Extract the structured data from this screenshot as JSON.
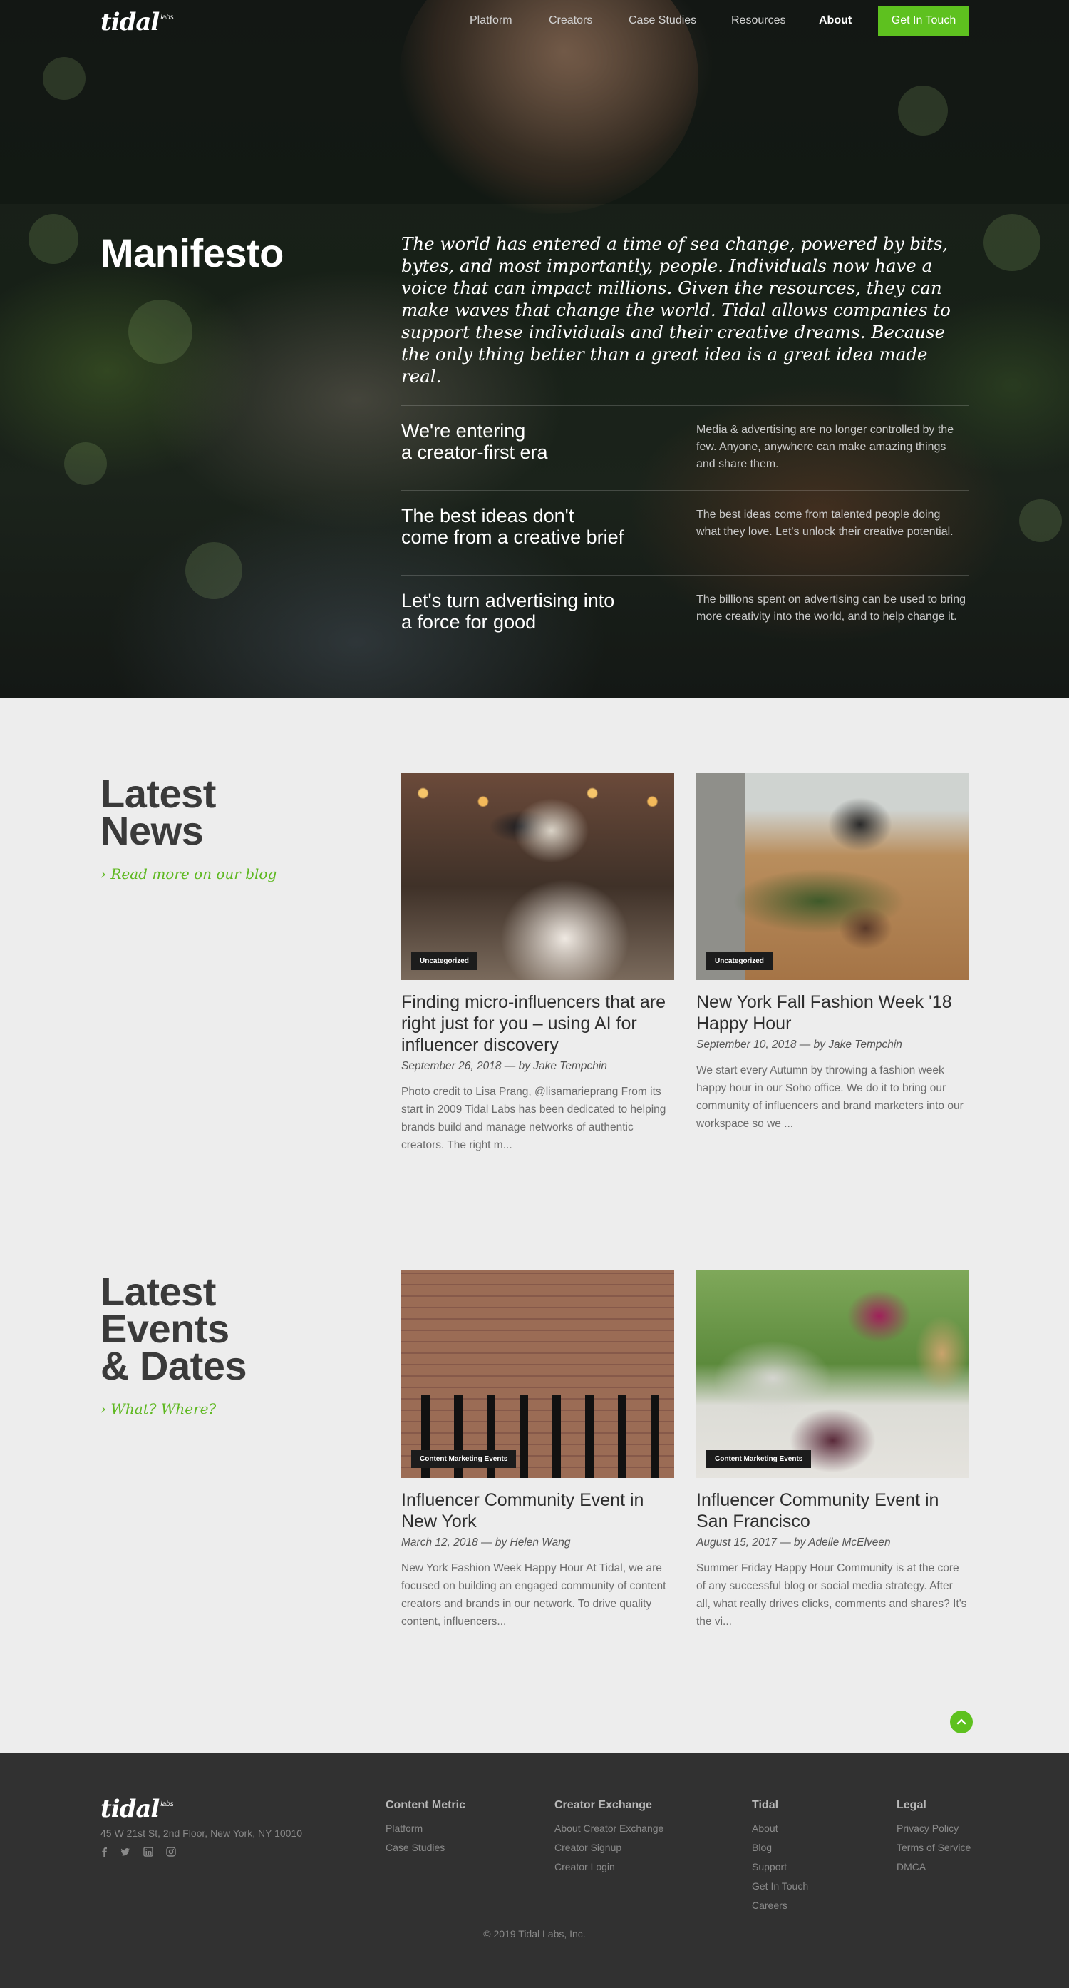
{
  "brand": {
    "logo_word": "tidal",
    "logo_sub": "labs"
  },
  "nav": {
    "items": [
      "Platform",
      "Creators",
      "Case Studies",
      "Resources",
      "About"
    ],
    "active": "About",
    "cta_label": "Get In Touch"
  },
  "manifesto": {
    "title": "Manifesto",
    "text": "The world has entered a time of sea change, powered by bits, bytes, and most importantly, people. Individuals now have a voice that can impact millions. Given the resources, they can make waves that change the world. Tidal allows companies to support these individuals and their creative dreams. Because the only thing better than a great idea is a great idea made real.",
    "rows": [
      {
        "heading_l1": "We're entering",
        "heading_l2": "a creator-first era",
        "body": "Media & advertising are no longer controlled by the few. Anyone, anywhere can make amazing things and share them."
      },
      {
        "heading_l1": "The best ideas don't",
        "heading_l2": "come from a creative brief",
        "body": "The best ideas come from talented people doing what they love. Let's unlock their creative potential."
      },
      {
        "heading_l1": "Let's turn advertising into",
        "heading_l2": "a force for good",
        "body": "The billions spent on advertising can be used to bring more creativity into the world, and to help change it."
      }
    ]
  },
  "news": {
    "title_l1": "Latest",
    "title_l2": "News",
    "link": "› Read more on our blog",
    "cards": [
      {
        "badge": "Uncategorized",
        "title": "Finding micro-influencers that are right just for you – using AI for influencer discovery",
        "meta": "September 26, 2018 — by Jake Tempchin",
        "excerpt": "Photo credit to Lisa Prang, @lisamarieprang From its start in 2009 Tidal Labs has been dedicated to helping brands build and manage networks of authentic creators. The right m..."
      },
      {
        "badge": "Uncategorized",
        "title": "New York Fall Fashion Week '18 Happy Hour",
        "meta": "September 10, 2018 — by Jake Tempchin",
        "excerpt": "We start every Autumn by throwing a fashion week happy hour in our Soho office. We do it to bring our community of influencers and brand marketers into our workspace so we ..."
      }
    ]
  },
  "events": {
    "title_l1": "Latest",
    "title_l2": "Events",
    "title_l3": "& Dates",
    "link": "› What? Where?",
    "cards": [
      {
        "badge": "Content Marketing Events",
        "title": "Influencer Community Event in New York",
        "meta": "March 12, 2018 — by Helen Wang",
        "excerpt": "New York Fashion Week Happy Hour At Tidal, we are focused on building an engaged community of content creators and brands in our network. To drive quality content, influencers..."
      },
      {
        "badge": "Content Marketing Events",
        "title": "Influencer Community Event in San Francisco",
        "meta": "August 15, 2017 — by Adelle McElveen",
        "excerpt": "Summer Friday Happy Hour Community is at the core of any successful blog or social media strategy. After all, what really drives clicks, comments and shares? It's the vi..."
      }
    ]
  },
  "footer": {
    "address": "45 W 21st St, 2nd Floor, New York, NY 10010",
    "social_icons": [
      "facebook-icon",
      "twitter-icon",
      "linkedin-icon",
      "instagram-icon"
    ],
    "columns": [
      {
        "heading": "Content Metric",
        "links": [
          "Platform",
          "Case Studies"
        ]
      },
      {
        "heading": "Creator Exchange",
        "links": [
          "About Creator Exchange",
          "Creator Signup",
          "Creator Login"
        ]
      },
      {
        "heading": "Tidal",
        "links": [
          "About",
          "Blog",
          "Support",
          "Get In Touch",
          "Careers"
        ]
      },
      {
        "heading": "Legal",
        "links": [
          "Privacy Policy",
          "Terms of Service",
          "DMCA"
        ]
      }
    ],
    "copyright": "© 2019 Tidal Labs, Inc."
  },
  "colors": {
    "accent": "#5ec11f",
    "footer_bg": "#313131",
    "page_bg": "#ededed"
  }
}
